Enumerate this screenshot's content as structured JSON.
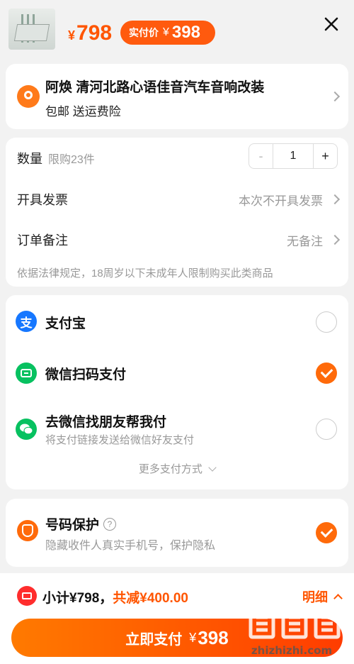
{
  "header": {
    "currency": "¥",
    "original_price": "798",
    "actual_label": "实付价",
    "actual_price": "398"
  },
  "address": {
    "name_line": "阿焕 清河北路心语佳音汽车音响改装",
    "sub_line": "包邮 送运费险"
  },
  "options": {
    "quantity_label": "数量",
    "quantity_limit": "限购23件",
    "quantity_minus": "-",
    "quantity_value": "1",
    "quantity_plus": "+",
    "invoice_label": "开具发票",
    "invoice_value": "本次不开具发票",
    "note_label": "订单备注",
    "note_value": "无备注",
    "legal_text": "依据法律规定，18周岁以下未成年人限制购买此类商品"
  },
  "payment": {
    "methods": [
      {
        "name": "支付宝",
        "sub": "",
        "selected": false,
        "icon": "alipay-icon",
        "icon_char": "支",
        "color": "#1677ff"
      },
      {
        "name": "微信扫码支付",
        "sub": "",
        "selected": true,
        "icon": "wechat-scan-icon",
        "icon_char": "",
        "color": "#07c160"
      },
      {
        "name": "去微信找朋友帮我付",
        "sub": "将支付链接发送给微信好友支付",
        "selected": false,
        "icon": "wechat-icon",
        "icon_char": "",
        "color": "#07c160"
      }
    ],
    "more_label": "更多支付方式"
  },
  "protect": {
    "title": "号码保护",
    "help": "?",
    "subtitle": "隐藏收件人真实手机号，保护隐私",
    "selected": true
  },
  "footer": {
    "subtotal_label": "小计¥798，",
    "discount_label": "共减¥400.00",
    "detail_label": "明细",
    "pay_button_label": "立即支付",
    "pay_button_currency": "¥",
    "pay_button_amount": "398"
  },
  "watermark": {
    "brand": "值值值",
    "site": "zhizhizhi.com"
  },
  "colors": {
    "accent": "#ff5500",
    "alipay": "#1677ff",
    "wechat": "#07c160"
  }
}
